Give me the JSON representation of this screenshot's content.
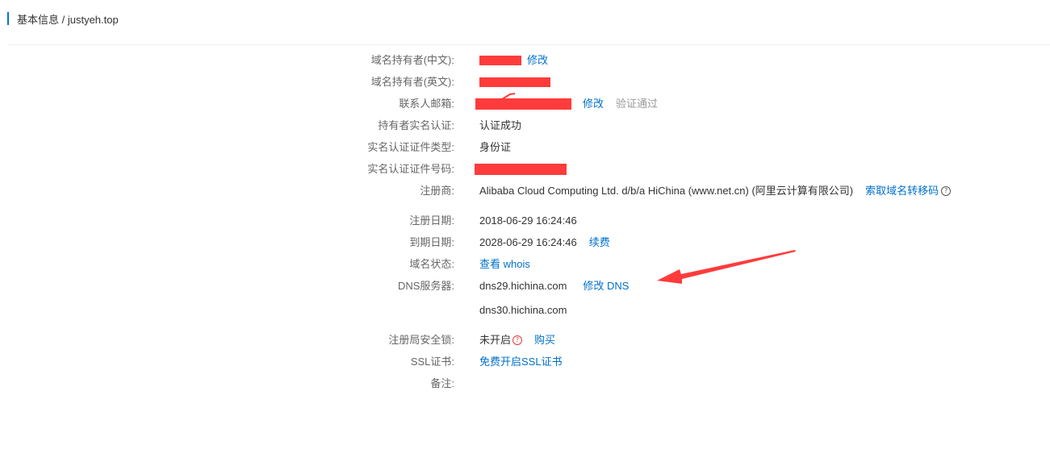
{
  "header": {
    "title": "基本信息 / justyeh.top"
  },
  "fields": {
    "owner_cn": {
      "label": "域名持有者(中文):",
      "action": "修改"
    },
    "owner_en": {
      "label": "域名持有者(英文):"
    },
    "email": {
      "label": "联系人邮箱:",
      "action": "修改",
      "status": "验证通过"
    },
    "realname": {
      "label": "持有者实名认证:",
      "value": "认证成功"
    },
    "cert_type": {
      "label": "实名认证证件类型:",
      "value": "身份证"
    },
    "cert_no": {
      "label": "实名认证证件号码:"
    },
    "registrar": {
      "label": "注册商:",
      "value": "Alibaba Cloud Computing Ltd. d/b/a HiChina (www.net.cn) (阿里云计算有限公司)",
      "action": "索取域名转移码"
    },
    "reg_date": {
      "label": "注册日期:",
      "value": "2018-06-29 16:24:46"
    },
    "exp_date": {
      "label": "到期日期:",
      "value": "2028-06-29 16:24:46",
      "action": "续费"
    },
    "status": {
      "label": "域名状态:",
      "action": "查看 whois"
    },
    "dns": {
      "label": "DNS服务器:",
      "values": [
        "dns29.hichina.com",
        "dns30.hichina.com"
      ],
      "action": "修改 DNS"
    },
    "lock": {
      "label": "注册局安全锁:",
      "value": "未开启",
      "action": "购买"
    },
    "ssl": {
      "label": "SSL证书:",
      "action": "免费开启SSL证书"
    },
    "remark": {
      "label": "备注:"
    }
  },
  "icons": {
    "help": "question-circle-icon",
    "arrow": "annotation-arrow"
  },
  "colors": {
    "link": "#0070cc",
    "redaction": "#ff3b3b",
    "accent_bar": "#0077cc"
  }
}
